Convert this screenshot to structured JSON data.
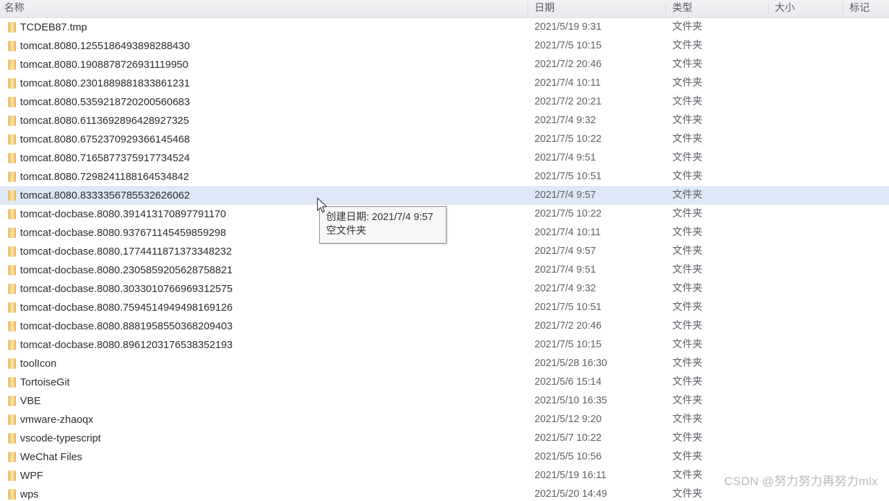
{
  "header": {
    "columns": [
      {
        "key": "name",
        "label": "名称"
      },
      {
        "key": "date",
        "label": "日期"
      },
      {
        "key": "type",
        "label": "类型"
      },
      {
        "key": "size",
        "label": "大小"
      },
      {
        "key": "tag",
        "label": "标记"
      }
    ]
  },
  "selection": {
    "selected_row_index": 9,
    "highlight_color": "#dfe8f6"
  },
  "icons": {
    "folder": "folder-icon",
    "cursor": "mouse-pointer-icon"
  },
  "tooltip": {
    "line1": "创建日期: 2021/7/4 9:57",
    "line2": "空文件夹"
  },
  "watermark": {
    "text": "CSDN @努力努力再努力mlx"
  },
  "rows": [
    {
      "icon": "folder-icon",
      "name": "TCDEB87.tmp",
      "date": "2021/5/19 9:31",
      "type": "文件夹",
      "size": "",
      "tag": ""
    },
    {
      "icon": "folder-icon",
      "name": "tomcat.8080.1255186493898288430",
      "date": "2021/7/5 10:15",
      "type": "文件夹",
      "size": "",
      "tag": ""
    },
    {
      "icon": "folder-icon",
      "name": "tomcat.8080.1908878726931119950",
      "date": "2021/7/2 20:46",
      "type": "文件夹",
      "size": "",
      "tag": ""
    },
    {
      "icon": "folder-icon",
      "name": "tomcat.8080.2301889881833861231",
      "date": "2021/7/4 10:11",
      "type": "文件夹",
      "size": "",
      "tag": ""
    },
    {
      "icon": "folder-icon",
      "name": "tomcat.8080.5359218720200560683",
      "date": "2021/7/2 20:21",
      "type": "文件夹",
      "size": "",
      "tag": ""
    },
    {
      "icon": "folder-icon",
      "name": "tomcat.8080.6113692896428927325",
      "date": "2021/7/4 9:32",
      "type": "文件夹",
      "size": "",
      "tag": ""
    },
    {
      "icon": "folder-icon",
      "name": "tomcat.8080.6752370929366145468",
      "date": "2021/7/5 10:22",
      "type": "文件夹",
      "size": "",
      "tag": ""
    },
    {
      "icon": "folder-icon",
      "name": "tomcat.8080.7165877375917734524",
      "date": "2021/7/4 9:51",
      "type": "文件夹",
      "size": "",
      "tag": ""
    },
    {
      "icon": "folder-icon",
      "name": "tomcat.8080.7298241188164534842",
      "date": "2021/7/5 10:51",
      "type": "文件夹",
      "size": "",
      "tag": ""
    },
    {
      "icon": "folder-icon",
      "name": "tomcat.8080.8333356785532626062",
      "date": "2021/7/4 9:57",
      "type": "文件夹",
      "size": "",
      "tag": ""
    },
    {
      "icon": "folder-icon",
      "name": "tomcat-docbase.8080.391413170897791170",
      "date": "2021/7/5 10:22",
      "type": "文件夹",
      "size": "",
      "tag": ""
    },
    {
      "icon": "folder-icon",
      "name": "tomcat-docbase.8080.937671145459859298",
      "date": "2021/7/4 10:11",
      "type": "文件夹",
      "size": "",
      "tag": ""
    },
    {
      "icon": "folder-icon",
      "name": "tomcat-docbase.8080.1774411871373348232",
      "date": "2021/7/4 9:57",
      "type": "文件夹",
      "size": "",
      "tag": ""
    },
    {
      "icon": "folder-icon",
      "name": "tomcat-docbase.8080.2305859205628758821",
      "date": "2021/7/4 9:51",
      "type": "文件夹",
      "size": "",
      "tag": ""
    },
    {
      "icon": "folder-icon",
      "name": "tomcat-docbase.8080.3033010766969312575",
      "date": "2021/7/4 9:32",
      "type": "文件夹",
      "size": "",
      "tag": ""
    },
    {
      "icon": "folder-icon",
      "name": "tomcat-docbase.8080.7594514949498169126",
      "date": "2021/7/5 10:51",
      "type": "文件夹",
      "size": "",
      "tag": ""
    },
    {
      "icon": "folder-icon",
      "name": "tomcat-docbase.8080.8881958550368209403",
      "date": "2021/7/2 20:46",
      "type": "文件夹",
      "size": "",
      "tag": ""
    },
    {
      "icon": "folder-icon",
      "name": "tomcat-docbase.8080.8961203176538352193",
      "date": "2021/7/5 10:15",
      "type": "文件夹",
      "size": "",
      "tag": ""
    },
    {
      "icon": "folder-icon",
      "name": "toolIcon",
      "date": "2021/5/28 16:30",
      "type": "文件夹",
      "size": "",
      "tag": ""
    },
    {
      "icon": "folder-icon",
      "name": "TortoiseGit",
      "date": "2021/5/6 15:14",
      "type": "文件夹",
      "size": "",
      "tag": ""
    },
    {
      "icon": "folder-icon",
      "name": "VBE",
      "date": "2021/5/10 16:35",
      "type": "文件夹",
      "size": "",
      "tag": ""
    },
    {
      "icon": "folder-icon",
      "name": "vmware-zhaoqx",
      "date": "2021/5/12 9:20",
      "type": "文件夹",
      "size": "",
      "tag": ""
    },
    {
      "icon": "folder-icon",
      "name": "vscode-typescript",
      "date": "2021/5/7 10:22",
      "type": "文件夹",
      "size": "",
      "tag": ""
    },
    {
      "icon": "folder-icon",
      "name": "WeChat Files",
      "date": "2021/5/5 10:56",
      "type": "文件夹",
      "size": "",
      "tag": ""
    },
    {
      "icon": "folder-icon",
      "name": "WPF",
      "date": "2021/5/19 16:11",
      "type": "文件夹",
      "size": "",
      "tag": ""
    },
    {
      "icon": "folder-icon",
      "name": "wps",
      "date": "2021/5/20 14:49",
      "type": "文件夹",
      "size": "",
      "tag": ""
    }
  ]
}
